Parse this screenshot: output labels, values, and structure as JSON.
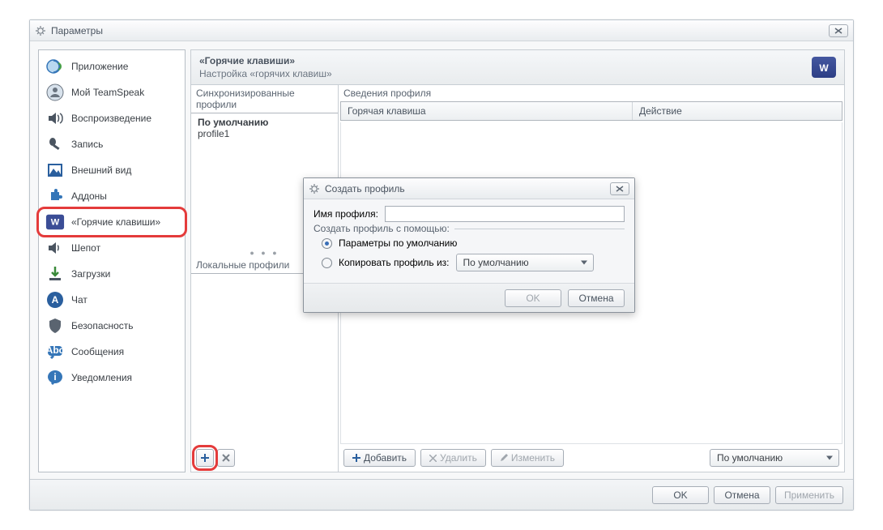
{
  "window": {
    "title": "Параметры"
  },
  "sidebar": {
    "items": [
      {
        "label": "Приложение"
      },
      {
        "label": "Мой TeamSpeak"
      },
      {
        "label": "Воспроизведение"
      },
      {
        "label": "Запись"
      },
      {
        "label": "Внешний вид"
      },
      {
        "label": "Аддоны"
      },
      {
        "label": "«Горячие клавиши»"
      },
      {
        "label": "Шепот"
      },
      {
        "label": "Загрузки"
      },
      {
        "label": "Чат"
      },
      {
        "label": "Безопасность"
      },
      {
        "label": "Сообщения"
      },
      {
        "label": "Уведомления"
      }
    ]
  },
  "header": {
    "title": "«Горячие клавиши»",
    "subtitle": "Настройка «горячих клавиш»"
  },
  "sections": {
    "synced_label": "Синхронизированные профили",
    "local_label": "Локальные профили",
    "synced_items": [
      "По умолчанию",
      "profile1"
    ],
    "details_label": "Сведения профиля",
    "col_hotkey": "Горячая клавиша",
    "col_action": "Действие"
  },
  "toolbar": {
    "add": "Добавить",
    "delete": "Удалить",
    "edit": "Изменить",
    "default_combo": "По умолчанию"
  },
  "footer": {
    "ok": "OK",
    "cancel": "Отмена",
    "apply": "Применить"
  },
  "dialog": {
    "title": "Создать профиль",
    "name_label": "Имя профиля:",
    "legend": "Создать профиль с помощью:",
    "opt_default": "Параметры по умолчанию",
    "opt_copy": "Копировать профиль из:",
    "copy_combo": "По умолчанию",
    "ok": "OK",
    "cancel": "Отмена"
  }
}
